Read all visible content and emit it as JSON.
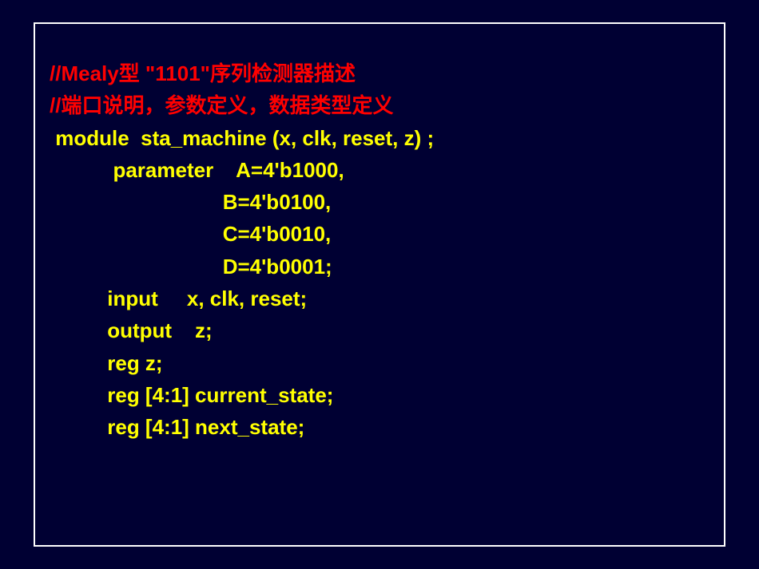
{
  "slide": {
    "comment1": "//Mealy型 \"1101\"序列检测器描述",
    "comment2": "//端口说明，参数定义，数据类型定义",
    "line3": " module  sta_machine (x, clk, reset, z) ;",
    "line4": "           parameter    A=4'b1000,",
    "line5": "                              B=4'b0100,",
    "line6": "                              C=4'b0010,",
    "line7": "                              D=4'b0001;",
    "line8": "          input     x, clk, reset;",
    "line9": "          output    z;",
    "line10": "          reg z;",
    "line11": "          reg [4:1] current_state;",
    "line12": "          reg [4:1] next_state;"
  }
}
